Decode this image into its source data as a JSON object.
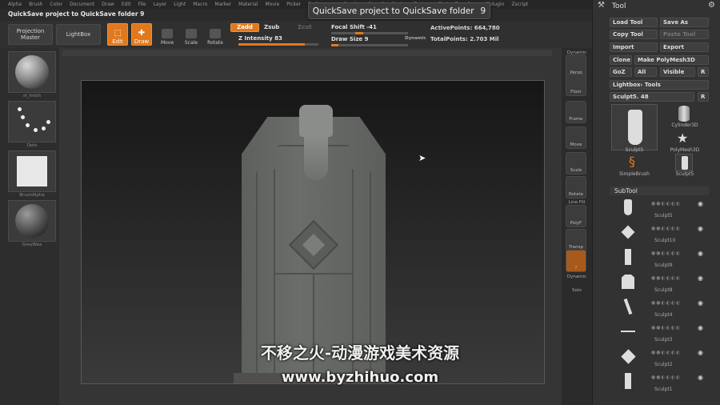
{
  "menu": [
    "Alpha",
    "Brush",
    "Color",
    "Document",
    "Draw",
    "Edit",
    "File",
    "Layer",
    "Light",
    "Macro",
    "Marker",
    "Material",
    "Movie",
    "Picker",
    "Preferences",
    "Render",
    "Stencil",
    "Stroke",
    "Texture",
    "Tool",
    "Transform",
    "Zplugin",
    "Zscript"
  ],
  "quicksave": {
    "line": "QuickSave project to QuickSave folder  9",
    "toast_text": "QuickSave project to QuickSave folder",
    "toast_count": "9"
  },
  "toolbar": {
    "projection_master": "Projection Master",
    "lightbox": "LightBox",
    "edit": "Edit",
    "draw": "Draw",
    "move": "Move",
    "scale": "Scale",
    "rotate": "Rotate",
    "zadd": "Zadd",
    "zsub": "Zsub",
    "zcut": "Zcut",
    "z_intensity": "Z Intensity 83",
    "focal_shift": "Focal Shift -41",
    "draw_size": "Draw Size 9",
    "dynamic": "Dynamic",
    "active_points": "ActivePoints: 664,780",
    "total_points": "TotalPoints: 2.703 Mil",
    "z_intensity_value": 0.83,
    "draw_size_value": 0.09
  },
  "shelf": {
    "brush": "st_Inlish",
    "stroke": "Dots",
    "alpha": "BrushAlpha",
    "material": "GreyWax"
  },
  "dock": [
    "Dynamic",
    "Persp",
    "Floor",
    "Frame",
    "Move",
    "Scale",
    "Rotate",
    "Line Fill",
    "PolyF",
    "Transp",
    "Dynamic",
    "Solo"
  ],
  "tool": {
    "title": "Tool",
    "load_tool": "Load Tool",
    "save_as": "Save As",
    "copy_tool": "Copy Tool",
    "paste_tool": "Paste Tool",
    "import": "Import",
    "export": "Export",
    "clone": "Clone",
    "make_polymesh": "Make PolyMesh3D",
    "goz": "GoZ",
    "all": "All",
    "visible": "Visible",
    "r": "R",
    "lightbox_tools": "Lightbox› Tools",
    "current_tool": "Sculpt5. 48",
    "thumbs": [
      "Sculpt5",
      "Cylinder3D",
      "PolyMesh3D",
      "SimpleBrush",
      "Sculpt5"
    ]
  },
  "subtool": {
    "header": "SubTool",
    "items": [
      "Sculpt5",
      "Sculpt10",
      "Sculpt9",
      "Sculpt8",
      "Sculpt4",
      "Sculpt3",
      "Sculpt2",
      "Sculpt1"
    ]
  },
  "watermark": {
    "line1": "不移之火-动漫游戏美术资源",
    "line2": "www.byzhihuo.com"
  }
}
